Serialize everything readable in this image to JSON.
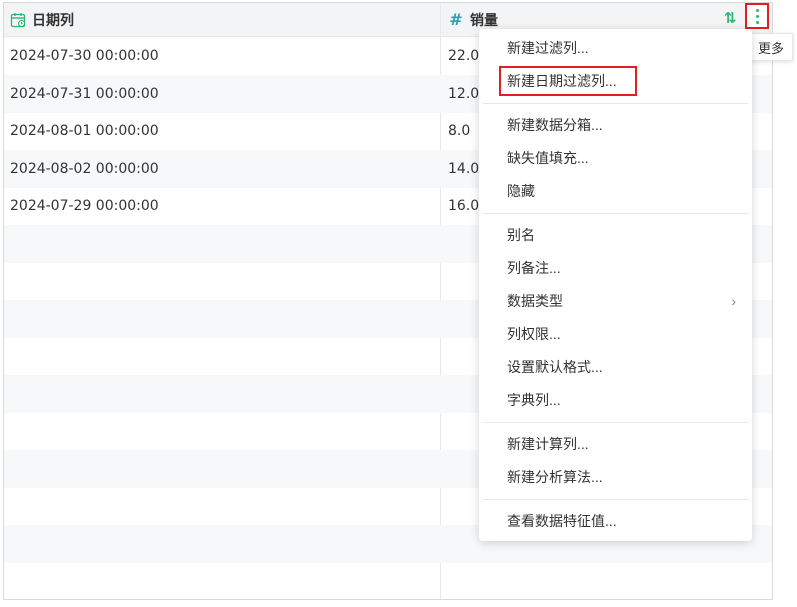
{
  "columns": [
    {
      "name": "日期列",
      "icon": "calendar-icon"
    },
    {
      "name": "销量",
      "icon": "hash-icon"
    }
  ],
  "header_actions": {
    "sort_icon": "sort-icon",
    "more_icon": "more-vertical-icon",
    "more_tooltip": "更多"
  },
  "rows": [
    {
      "date": "2024-07-30 00:00:00",
      "sales": "22.0"
    },
    {
      "date": "2024-07-31 00:00:00",
      "sales": "12.0"
    },
    {
      "date": "2024-08-01 00:00:00",
      "sales": "8.0"
    },
    {
      "date": "2024-08-02 00:00:00",
      "sales": "14.0"
    },
    {
      "date": "2024-07-29 00:00:00",
      "sales": "16.0"
    }
  ],
  "menu": {
    "items": [
      "新建过滤列...",
      "新建日期过滤列...",
      "新建数据分箱...",
      "缺失值填充...",
      "隐藏",
      "别名",
      "列备注...",
      "数据类型",
      "列权限...",
      "设置默认格式...",
      "字典列...",
      "新建计算列...",
      "新建分析算法...",
      "查看数据特征值..."
    ],
    "highlighted_index": 1
  },
  "colors": {
    "accent_green": "#2bb673",
    "hash_blue": "#2a9fb5",
    "highlight_red": "#e02020"
  }
}
